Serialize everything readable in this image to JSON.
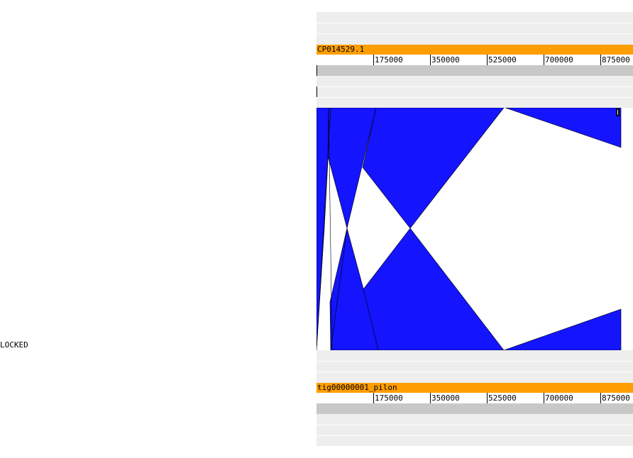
{
  "status": {
    "locked_label": "LOCKED"
  },
  "reference": {
    "name": "CP014529.1",
    "ticks": [
      "175000",
      "350000",
      "525000",
      "700000",
      "875000"
    ]
  },
  "query": {
    "name": "tig00000001_pilon",
    "ticks": [
      "175000",
      "350000",
      "525000",
      "700000",
      "875000"
    ]
  },
  "colors": {
    "sequence_bar": "#ff9e00",
    "alignment_fill": "#1414ff",
    "track_stripe": "#eeeeee",
    "ruler_band": "#c8c8c8"
  }
}
